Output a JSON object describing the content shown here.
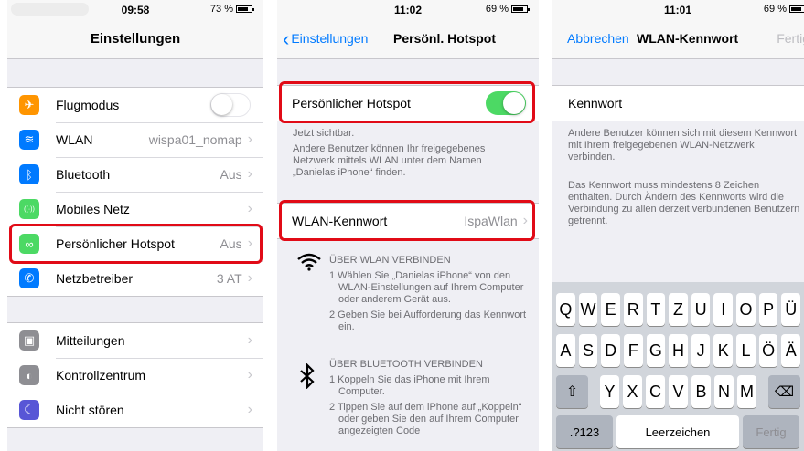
{
  "screen1": {
    "status": {
      "time": "09:58",
      "battery": "73 %"
    },
    "nav": {
      "title": "Einstellungen"
    },
    "group1": [
      {
        "label": "Flugmodus",
        "icon": "airplane-icon",
        "color": "#ff9500",
        "glyph": "✈",
        "value": "",
        "toggle": "off"
      },
      {
        "label": "WLAN",
        "icon": "wifi-icon",
        "color": "#007aff",
        "glyph": "≋",
        "value": "wispa01_nomap"
      },
      {
        "label": "Bluetooth",
        "icon": "bluetooth-icon",
        "color": "#007aff",
        "glyph": "ᛒ",
        "value": "Aus"
      },
      {
        "label": "Mobiles Netz",
        "icon": "cellular-icon",
        "color": "#4cd964",
        "glyph": "((·))",
        "value": ""
      },
      {
        "label": "Persönlicher Hotspot",
        "icon": "hotspot-icon",
        "color": "#4cd964",
        "glyph": "∞",
        "value": "Aus"
      },
      {
        "label": "Netzbetreiber",
        "icon": "phone-icon",
        "color": "#007aff",
        "glyph": "✆",
        "value": "3 AT"
      }
    ],
    "group2": [
      {
        "label": "Mitteilungen",
        "icon": "notifications-icon",
        "color": "#8e8e93",
        "glyph": "▣"
      },
      {
        "label": "Kontrollzentrum",
        "icon": "control-center-icon",
        "color": "#8e8e93",
        "glyph": "◐"
      },
      {
        "label": "Nicht stören",
        "icon": "moon-icon",
        "color": "#5856d6",
        "glyph": "☾"
      }
    ]
  },
  "screen2": {
    "status": {
      "time": "11:02",
      "battery": "69 %"
    },
    "nav": {
      "back": "Einstellungen",
      "title": "Persönl. Hotspot"
    },
    "hotspot_label": "Persönlicher Hotspot",
    "visible_note": "Jetzt sichtbar.",
    "others_note": "Andere Benutzer können Ihr freigegebenes Netzwerk mittels WLAN unter dem Namen „Danielas iPhone“ finden.",
    "password_label": "WLAN-Kennwort",
    "password_value": "IspaWlan",
    "wlan_heading": "ÜBER WLAN VERBINDEN",
    "wlan_step1": "1 Wählen Sie „Danielas iPhone“ von den WLAN-Einstellungen auf Ihrem Computer oder anderem Gerät aus.",
    "wlan_step2": "2 Geben Sie bei Aufforderung das Kennwort ein.",
    "bt_heading": "ÜBER BLUETOOTH VERBINDEN",
    "bt_step1": "1 Koppeln Sie das iPhone mit Ihrem Computer.",
    "bt_step2": "2 Tippen Sie auf dem iPhone auf „Koppeln“ oder geben Sie den auf Ihrem Computer angezeigten Code"
  },
  "screen3": {
    "status": {
      "time": "11:01",
      "battery": "69 %"
    },
    "nav": {
      "cancel": "Abbrechen",
      "title": "WLAN-Kennwort",
      "done": "Fertig"
    },
    "field_label": "Kennwort",
    "note1": "Andere Benutzer können sich mit diesem Kennwort mit Ihrem freigegebenen WLAN-Netzwerk verbinden.",
    "note2": "Das Kennwort muss mindestens 8 Zeichen enthalten. Durch Ändern des Kennworts wird die Verbindung zu allen derzeit verbundenen Benutzern getrennt.",
    "keyboard": {
      "row1": [
        "Q",
        "W",
        "E",
        "R",
        "T",
        "Z",
        "U",
        "I",
        "O",
        "P",
        "Ü"
      ],
      "row2": [
        "A",
        "S",
        "D",
        "F",
        "G",
        "H",
        "J",
        "K",
        "L",
        "Ö",
        "Ä"
      ],
      "row3": [
        "Y",
        "X",
        "C",
        "V",
        "B",
        "N",
        "M"
      ],
      "numbers": ".?123",
      "space": "Leerzeichen",
      "done": "Fertig"
    }
  }
}
